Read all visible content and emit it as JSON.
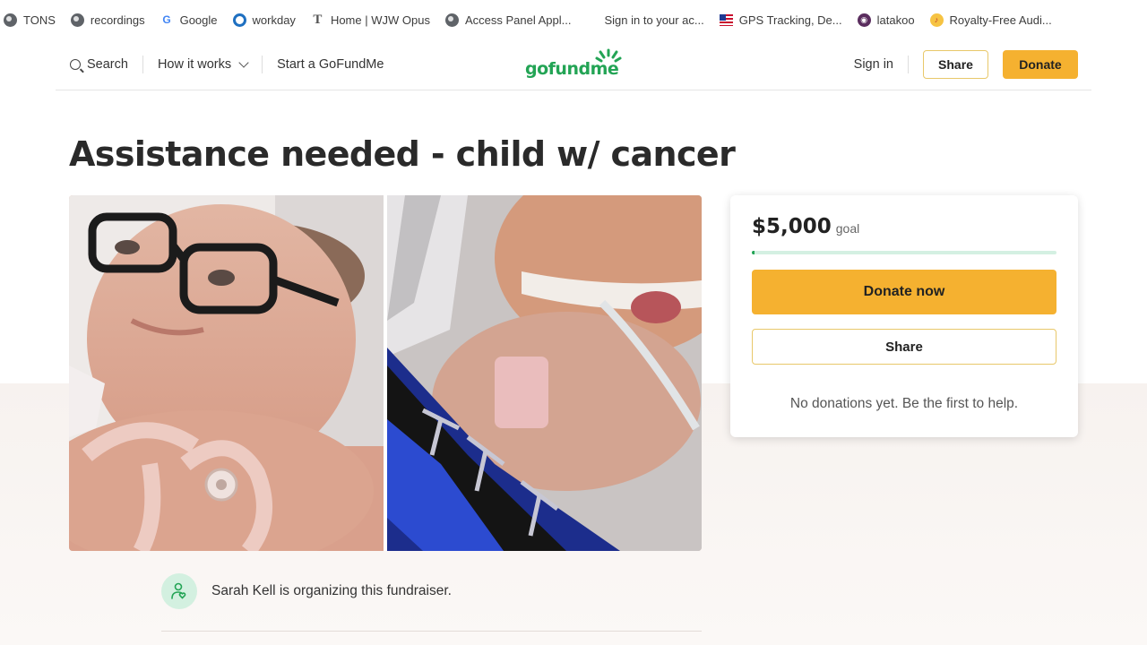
{
  "bookmarks": [
    {
      "label": "TONS",
      "icon": "globe-icon"
    },
    {
      "label": "recordings",
      "icon": "globe-icon"
    },
    {
      "label": "Google",
      "icon": "google-icon"
    },
    {
      "label": "workday",
      "icon": "workday-icon"
    },
    {
      "label": "Home | WJW Opus",
      "icon": "opus-icon"
    },
    {
      "label": "Access Panel Appl...",
      "icon": "globe-icon"
    },
    {
      "label": "Sign in to your ac...",
      "icon": "microsoft-icon"
    },
    {
      "label": "GPS Tracking, De...",
      "icon": "flag-icon"
    },
    {
      "label": "latakoo",
      "icon": "latakoo-icon"
    },
    {
      "label": "Royalty-Free Audi...",
      "icon": "royalty-icon"
    }
  ],
  "header": {
    "search_label": "Search",
    "how_it_works_label": "How it works",
    "start_label": "Start a GoFundMe",
    "logo_text": "gofundme",
    "sign_in_label": "Sign in",
    "share_label": "Share",
    "donate_label": "Donate"
  },
  "campaign": {
    "title": "Assistance needed - child w/ cancer",
    "organizer_text": "Sarah Kell is organizing this fundraiser."
  },
  "card": {
    "goal_amount": "$5,000",
    "goal_label": "goal",
    "progress_fraction": 0.01,
    "donate_now_label": "Donate now",
    "share_label": "Share",
    "no_donations_text": "No donations yet. Be the first to help."
  },
  "colors": {
    "brand_green": "#23a455",
    "accent_yellow": "#f5b130",
    "progress_track": "#d4f0e2"
  }
}
